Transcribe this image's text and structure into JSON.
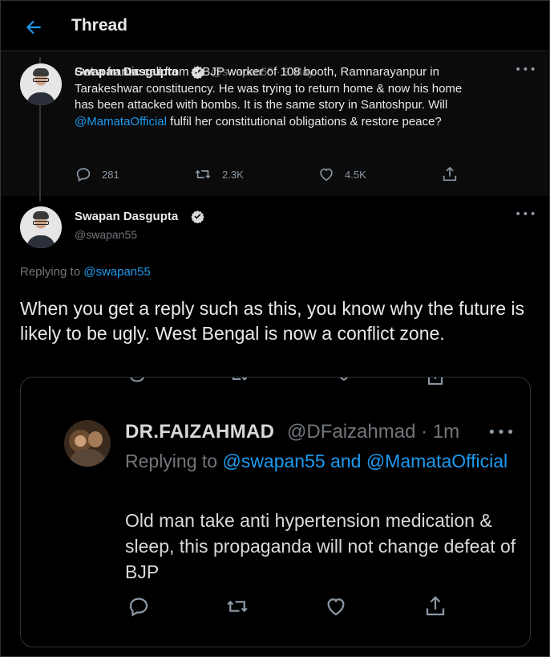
{
  "header": {
    "title": "Thread",
    "back_icon": "back-arrow-icon"
  },
  "parent_tweet": {
    "author_name": "Swapan Dasgupta",
    "handle_date": "@swapan55 · 9 May",
    "text_lines": [
      "Got a frantic call from a BJP worker of 108 booth, Ramnarayanpur in",
      "Tarakeshwar constituency. He was trying to return home & now his home",
      "has been attacked with bombs. It is the same story in Santoshpur. Will"
    ],
    "mention": "@MamataOfficial",
    "text_tail": " fulfil her constitutional obligations & restore peace?",
    "replies": "281",
    "retweets": "2.3K",
    "likes": "4.5K"
  },
  "main_tweet": {
    "author_name": "Swapan Dasgupta",
    "handle": "@swapan55",
    "replying_prefix": "Replying to ",
    "replying_handle": "@swapan55",
    "text": "When you get a reply such as this, you know why the future is likely to be ugly. West Bengal is now a conflict zone."
  },
  "embedded_reply": {
    "author_name": "DR.FAIZAHMAD",
    "handle_time": "@DFaizahmad · 1m",
    "replying_prefix": "Replying to ",
    "replying_handles": "@swapan55 and @MamataOfficial",
    "text": "Old man take anti hypertension medication & sleep, this propaganda will not change defeat of BJP"
  },
  "colors": {
    "accent": "#1d9bf0",
    "background": "#000000",
    "muted": "#71767b"
  }
}
